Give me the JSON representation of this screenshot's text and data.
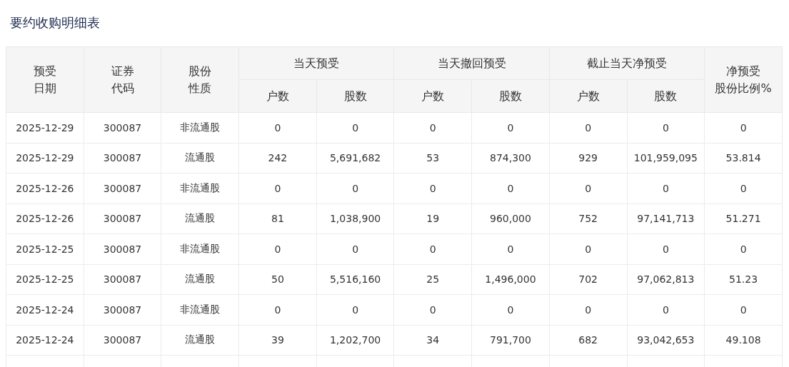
{
  "title": "要约收购明细表",
  "table": {
    "header_groups": [
      {
        "lines": [
          "预受",
          "日期"
        ]
      },
      {
        "lines": [
          "证券",
          "代码"
        ]
      },
      {
        "lines": [
          "股份",
          "性质"
        ]
      },
      {
        "lines": [
          "当天预受"
        ],
        "sub": [
          "户数",
          "股数"
        ]
      },
      {
        "lines": [
          "当天撤回预受"
        ],
        "sub": [
          "户数",
          "股数"
        ]
      },
      {
        "lines": [
          "截止当天净预受"
        ],
        "sub": [
          "户数",
          "股数"
        ]
      },
      {
        "lines": [
          "净预受",
          "股份比例%"
        ]
      }
    ],
    "rows": [
      [
        "2025-12-29",
        "300087",
        "非流通股",
        "0",
        "0",
        "0",
        "0",
        "0",
        "0",
        "0"
      ],
      [
        "2025-12-29",
        "300087",
        "流通股",
        "242",
        "5,691,682",
        "53",
        "874,300",
        "929",
        "101,959,095",
        "53.814"
      ],
      [
        "2025-12-26",
        "300087",
        "非流通股",
        "0",
        "0",
        "0",
        "0",
        "0",
        "0",
        "0"
      ],
      [
        "2025-12-26",
        "300087",
        "流通股",
        "81",
        "1,038,900",
        "19",
        "960,000",
        "752",
        "97,141,713",
        "51.271"
      ],
      [
        "2025-12-25",
        "300087",
        "非流通股",
        "0",
        "0",
        "0",
        "0",
        "0",
        "0",
        "0"
      ],
      [
        "2025-12-25",
        "300087",
        "流通股",
        "50",
        "5,516,160",
        "25",
        "1,496,000",
        "702",
        "97,062,813",
        "51.23"
      ],
      [
        "2025-12-24",
        "300087",
        "非流通股",
        "0",
        "0",
        "0",
        "0",
        "0",
        "0",
        "0"
      ],
      [
        "2025-12-24",
        "300087",
        "流通股",
        "39",
        "1,202,700",
        "34",
        "791,700",
        "682",
        "93,042,653",
        "49.108"
      ]
    ]
  }
}
